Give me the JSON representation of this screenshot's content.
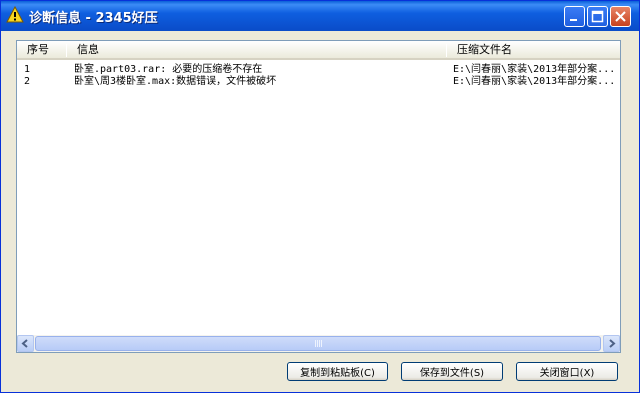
{
  "window": {
    "title": "诊断信息 - 2345好压"
  },
  "icons": {
    "title": "warning-icon",
    "minimize": "minimize-icon",
    "maximize": "maximize-icon",
    "close": "close-icon",
    "scroll_left": "arrow-left-icon",
    "scroll_right": "arrow-right-icon"
  },
  "colors": {
    "titlebar": "#0c55d4",
    "window_bg": "#ece9d8",
    "close_button": "#c8421e"
  },
  "list": {
    "columns": [
      "序号",
      "信息",
      "压缩文件名"
    ],
    "rows": [
      {
        "index": "1",
        "message": "卧室.part03.rar: 必要的压缩卷不存在",
        "archive": "E:\\闫春丽\\家装\\2013年部分案..."
      },
      {
        "index": "2",
        "message": "卧室\\周3楼卧室.max:数据错误，文件被破坏",
        "archive": "E:\\闫春丽\\家装\\2013年部分案..."
      }
    ]
  },
  "buttons": {
    "copy": "复制到粘贴板(C)",
    "save": "保存到文件(S)",
    "close": "关闭窗口(X)"
  }
}
